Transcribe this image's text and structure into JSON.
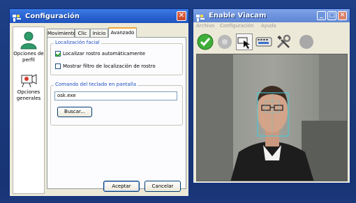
{
  "config_window": {
    "title": "Configuración",
    "close_label": "✕",
    "sidebar": [
      {
        "label": "Opciones de perfil",
        "icon": "user-profile-icon"
      },
      {
        "label": "Opciones generales",
        "icon": "camera-settings-icon"
      }
    ],
    "tabs": [
      {
        "label": "Movimiento",
        "active": false
      },
      {
        "label": "Clic",
        "active": false
      },
      {
        "label": "Inicio",
        "active": false
      },
      {
        "label": "Avanzado",
        "active": true
      }
    ],
    "face_group": {
      "title": "Localización facial",
      "options": [
        {
          "label": "Localizar rostro automáticamente",
          "checked": true
        },
        {
          "label": "Mostrar filtro de localización de rostro",
          "checked": false
        }
      ]
    },
    "keyboard_group": {
      "title": "Comando del teclado en pantalla",
      "command_value": "osk.exe",
      "browse_label": "Buscar..."
    },
    "accept_label": "Aceptar",
    "cancel_label": "Cancelar"
  },
  "viacam_window": {
    "title": "Enable Viacam",
    "minimize_label": "_",
    "maximize_label": "□",
    "close_label": "✕",
    "menu": [
      "Archivo",
      "Configuración",
      "Ayuda"
    ],
    "toolbar": [
      {
        "icon": "enable-check-icon"
      },
      {
        "icon": "disabled-gear-icon"
      },
      {
        "icon": "dwell-click-icon"
      },
      {
        "icon": "keyboard-icon"
      },
      {
        "icon": "tools-icon"
      },
      {
        "icon": "gray-circle-icon"
      }
    ]
  },
  "colors": {
    "desktop": "#1f3f86",
    "xp_titlebar": "#2a63cf",
    "active_tab_accent": "#f0a83a",
    "group_title": "#1f4fbd",
    "face_box": "#3fd0e0"
  }
}
